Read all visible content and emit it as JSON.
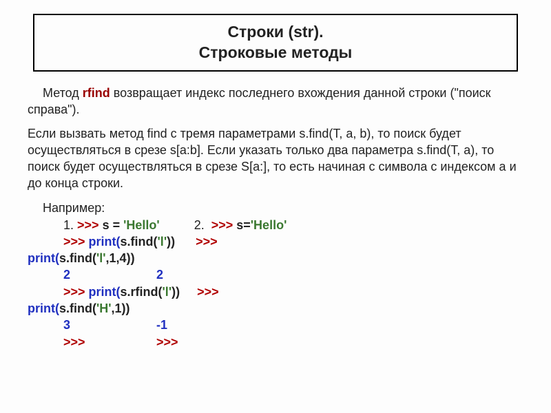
{
  "title": "Строки (str).\nСтроковые методы",
  "intro_lead": "Метод ",
  "intro_method": "rfind",
  "intro_rest": " возвращает индекс последнего вхождения данной строки (\"поиск справа\").",
  "para2": "Если вызвать метод find с тремя параметрами s.find(T, a, b), то поиск будет осуществляться в срезе s[a:b]. Если указать только два параметра s.find(T, a), то поиск будет осуществляться в срезе S[a:], то есть начиная с символа с индексом a и до конца строки.",
  "example_label": "Например:",
  "ex1_num": "1. ",
  "ex2_num": "2.  ",
  "prompt": ">>> ",
  "assign": "s = ",
  "assign2": "s=",
  "hello": "'Hello'",
  "print_open": "print(",
  "sfind_open": "s.find(",
  "srfind_open": "s.rfind(",
  "arg_l": "'l'",
  "arg_H": "'H'",
  "args_l14": ",1,4))",
  "args_H1": ",1))",
  "close2": "))",
  "res2": "2",
  "res2b": "2",
  "res3": "3",
  "resneg1": "-1"
}
